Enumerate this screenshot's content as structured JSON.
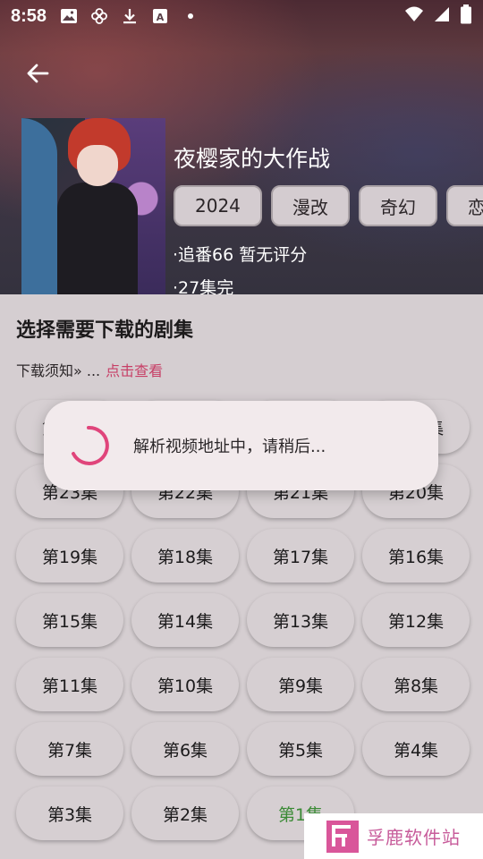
{
  "status_bar": {
    "time": "8:58",
    "icons": [
      "image-icon",
      "pinwheel-icon",
      "download-icon",
      "text-a-icon",
      "dot-icon"
    ],
    "right_icons": [
      "wifi-icon",
      "signal-icon",
      "battery-icon"
    ]
  },
  "header": {
    "back_icon": "arrow-left-icon",
    "title": "夜樱家的大作战",
    "tags": [
      "2024",
      "漫改",
      "奇幻",
      "恋"
    ],
    "meta_follow": "·追番66 暂无评分",
    "meta_episodes": "·27集完"
  },
  "sheet": {
    "title": "选择需要下载的剧集",
    "notice_text": "下载须知» ...",
    "notice_link": "点击查看",
    "episodes": [
      "第27集",
      "第26集",
      "第25集",
      "第24集",
      "第23集",
      "第22集",
      "第21集",
      "第20集",
      "第19集",
      "第18集",
      "第17集",
      "第16集",
      "第15集",
      "第14集",
      "第13集",
      "第12集",
      "第11集",
      "第10集",
      "第9集",
      "第8集",
      "第7集",
      "第6集",
      "第5集",
      "第4集",
      "第3集",
      "第2集",
      "第1集"
    ],
    "current_episode": "第1集"
  },
  "dialog": {
    "message": "解析视频地址中，请稍后..."
  },
  "watermark": {
    "text": "孚鹿软件站"
  },
  "colors": {
    "accent_pink": "#c73f66",
    "spinner": "#e0457b",
    "current_episode": "#3a8a35",
    "sheet_bg": "#d5ced1"
  }
}
